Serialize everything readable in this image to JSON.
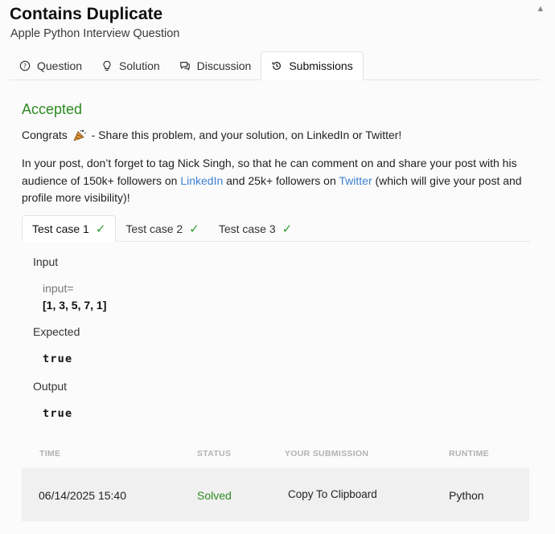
{
  "header": {
    "title": "Contains Duplicate",
    "subtitle": "Apple Python Interview Question"
  },
  "tabs": [
    {
      "label": "Question",
      "icon": "question-circle-icon"
    },
    {
      "label": "Solution",
      "icon": "lightbulb-icon"
    },
    {
      "label": "Discussion",
      "icon": "chat-bubble-icon"
    },
    {
      "label": "Submissions",
      "icon": "history-icon",
      "active": true
    }
  ],
  "result": {
    "status": "Accepted",
    "congrats_prefix": "Congrats",
    "congrats_suffix": "- Share this problem, and your solution, on LinkedIn or Twitter!",
    "para_part1": "In your post, don’t forget to tag Nick Singh, so that he can comment on and share your post with his audience of 150k+ followers on ",
    "linkedin_link": "LinkedIn",
    "para_part2": " and 25k+ followers on ",
    "twitter_link": "Twitter",
    "para_part3": " (which will give your post and profile more visibility)!"
  },
  "test_cases": [
    {
      "label": "Test case 1",
      "passed": true,
      "active": true
    },
    {
      "label": "Test case 2",
      "passed": true
    },
    {
      "label": "Test case 3",
      "passed": true
    }
  ],
  "test_detail": {
    "input_heading": "Input",
    "input_name": "input=",
    "input_value": "[1, 3, 5, 7, 1]",
    "expected_heading": "Expected",
    "expected_value": "true",
    "output_heading": "Output",
    "output_value": "true"
  },
  "submissions": {
    "columns": [
      "TIME",
      "STATUS",
      "YOUR SUBMISSION",
      "RUNTIME"
    ],
    "rows": [
      {
        "time": "06/14/2025 15:40",
        "status": "Solved",
        "submission": "Copy To Clipboard",
        "runtime": "Python"
      }
    ]
  },
  "colors": {
    "accepted": "#2e8b22",
    "link": "#3d7fcf",
    "check": "#2e9b2a"
  }
}
